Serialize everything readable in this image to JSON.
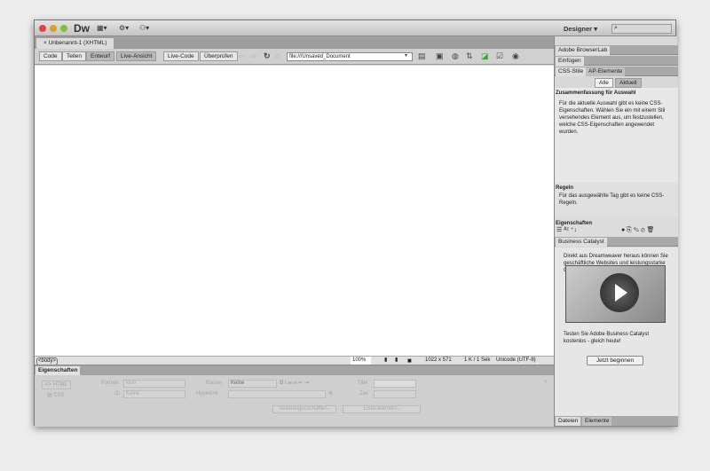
{
  "app": {
    "logo": "Dw",
    "workspace": "Designer",
    "workspace_arrow": "▾",
    "search_icon": "⌕"
  },
  "document": {
    "tab": "Unbenannt-1 (XHTML)",
    "close": "×"
  },
  "toolbar": {
    "code": "Code",
    "split": "Teilen",
    "design": "Entwurf",
    "live_view": "Live-Ansicht",
    "live_code": "Live-Code",
    "inspect": "Überprüfen",
    "address": "file:///Unsaved_Document"
  },
  "status": {
    "tag": "<body>",
    "zoom": "100%",
    "size": "1022 x 571",
    "download": "1 K / 1 Sek",
    "encoding": "Unicode (UTF-8)"
  },
  "properties": {
    "tab": "Eigenschaften",
    "html": "HTML",
    "css": "CSS",
    "format_label": "Format",
    "format_value": "kein",
    "id_label": "ID",
    "id_value": "Keine",
    "class_label": "Klasse",
    "class_value": "Keine",
    "link_label": "Hyperlink",
    "title_label": "Titel",
    "target_label": "Ziel",
    "page_props": "Seiteneigenschaften...",
    "list_item": "Listenelement..."
  },
  "panels": {
    "browserlab": "Adobe BrowserLab",
    "insert": "Einfügen",
    "css_styles": "CSS-Stile",
    "ap_elements": "AP-Elemente",
    "all": "Alle",
    "current": "Aktuell",
    "summary_title": "Zusammenfassung für Auswahl",
    "summary_text": "Für die aktuelle Auswahl gibt es keine CSS-Eigenschaften. Wählen Sie ein mit einem Stil versehendes Element aus, um festzustellen, welche CSS-Eigenschaften angewendet wurden.",
    "rules_title": "Regeln",
    "rules_text": "Für das ausgewählte Tag gibt es keine CSS-Regeln.",
    "props_title": "Eigenschaften",
    "bc_title": "Business Catalyst",
    "bc_text": "Direkt aus Dreamweaver heraus können Sie geschäftliche Websites und leistungsstarke Online-Shops erstellen und veröffentlichen.",
    "bc_try": "Testen Sie Adobe Business Catalyst kostenlos - gleich heute!",
    "bc_button": "Jetzt beginnen",
    "files": "Dateien",
    "assets": "Elemente"
  }
}
